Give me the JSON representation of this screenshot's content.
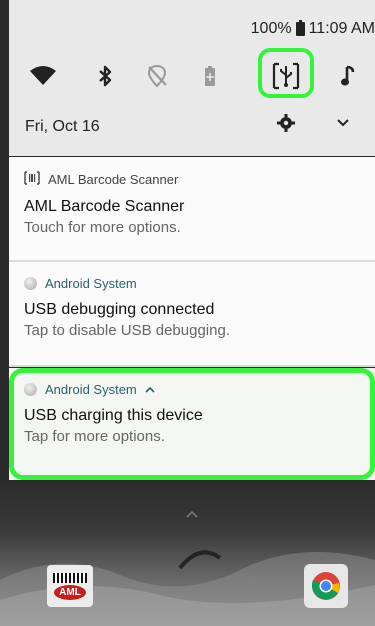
{
  "status_bar": {
    "battery": "100%",
    "time": "11:09 AM"
  },
  "quick_settings": {
    "tiles": [
      "wifi-icon",
      "bluetooth-icon",
      "location-off-icon",
      "battery-saver-icon",
      "usb-icon",
      "music-note-icon"
    ],
    "highlight_color": "#35f23a",
    "date": "Fri, Oct 16"
  },
  "notifications": [
    {
      "app": "AML Barcode Scanner",
      "title": "AML Barcode Scanner",
      "body": "Touch for more options."
    },
    {
      "app": "Android System",
      "title": "USB debugging connected",
      "body": "Tap to disable USB debugging."
    },
    {
      "app": "Android System",
      "title": "USB charging this device",
      "body": "Tap for more options."
    }
  ],
  "home": {
    "aml_badge": "AML"
  }
}
